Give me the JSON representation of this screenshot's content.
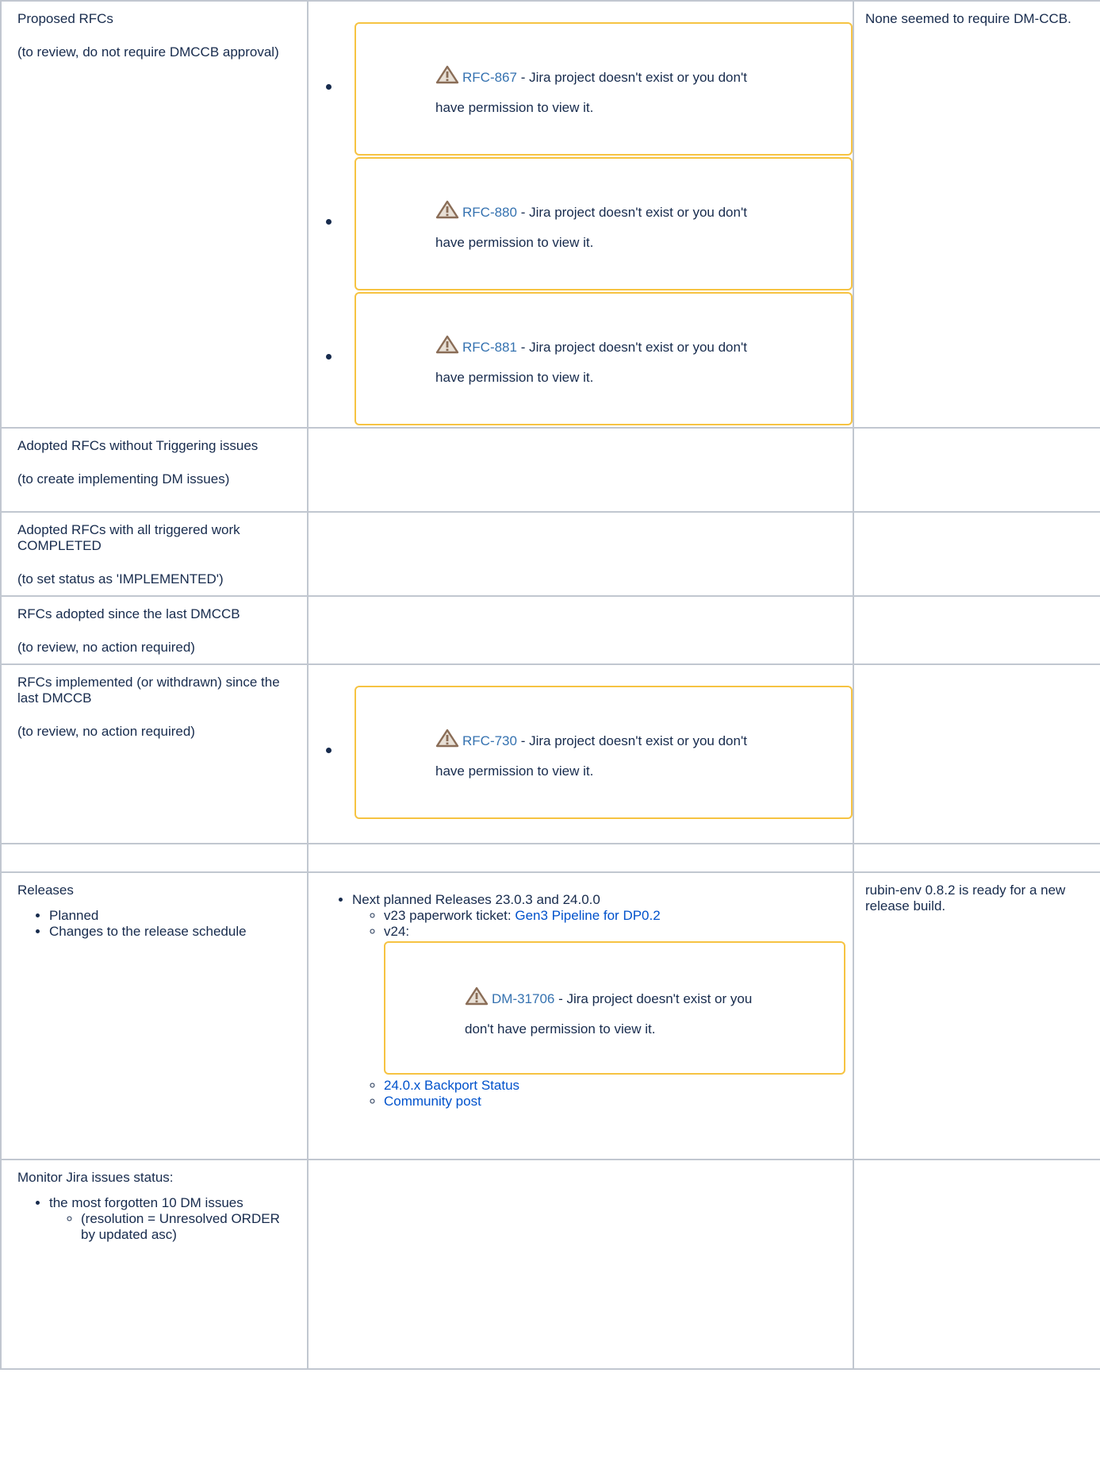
{
  "rows": {
    "proposed": {
      "title": "Proposed RFCs",
      "subtitle": "(to review, do not require DMCCB approval)",
      "notes": "None seemed to require DM-CCB.",
      "issues": [
        {
          "key": "RFC-867",
          "msg1": " - Jira project doesn't exist or you don't",
          "msg2": "have permission to view it."
        },
        {
          "key": "RFC-880",
          "msg1": " - Jira project doesn't exist or you don't",
          "msg2": "have permission to view it."
        },
        {
          "key": "RFC-881",
          "msg1": " - Jira project doesn't exist or you don't",
          "msg2": "have permission to view it."
        }
      ]
    },
    "adopted_no_trigger": {
      "title": " Adopted RFCs without Triggering issues",
      "subtitle": "(to create implementing DM issues)"
    },
    "adopted_completed": {
      "title": "Adopted RFCs with all triggered work COMPLETED",
      "subtitle": "(to set status as 'IMPLEMENTED')"
    },
    "adopted_since": {
      "title": "RFCs adopted since the last DMCCB",
      "subtitle": "(to review, no action required)"
    },
    "implemented_since": {
      "title": "RFCs implemented (or withdrawn) since the last DMCCB",
      "subtitle": "(to review, no action required)",
      "issues": [
        {
          "key": "RFC-730",
          "msg1": " - Jira project doesn't exist or you don't",
          "msg2": "have permission to view it."
        }
      ]
    },
    "releases": {
      "title": "Releases",
      "items": [
        "Planned",
        "Changes to the release schedule"
      ],
      "next_planned": "Next planned Releases 23.0.3 and 24.0.0",
      "v23_label": "v23 paperwork ticket: ",
      "v23_link": "Gen3 Pipeline for DP0.2",
      "v24_label": "v24:",
      "v24_issue": {
        "key": "DM-31706",
        "msg1": " - Jira project doesn't exist or you",
        "msg2": "don't have permission to view it."
      },
      "backport_link": "24.0.x Backport Status",
      "community_link": "Community post",
      "notes": "rubin-env 0.8.2 is ready for a new release build."
    },
    "monitor": {
      "title": "Monitor Jira issues status:",
      "item": "the most forgotten 10 DM issues",
      "subitem": "(resolution = Unresolved ORDER by updated asc)"
    }
  },
  "icons": {
    "warning": "warning-icon"
  },
  "colors": {
    "link": "#0052cc",
    "jira_link": "#3572b0",
    "warning_border": "#f6c342",
    "table_border": "#c1c7d0",
    "text": "#172b4d"
  }
}
